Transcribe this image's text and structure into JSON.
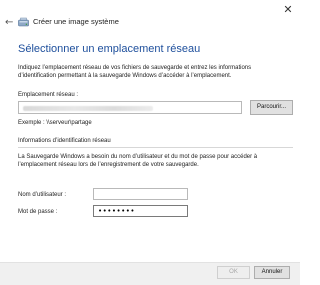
{
  "window": {
    "close_glyph": "✕",
    "back_glyph": "←",
    "app_title": "Créer une image système"
  },
  "page": {
    "title": "Sélectionner un emplacement réseau",
    "intro": "Indiquez l’emplacement réseau de vos fichiers de sauvegarde et entrez les informations d’identification permettant à la sauvegarde Windows d’accéder à l’emplacement."
  },
  "location": {
    "label": "Emplacement réseau :",
    "browse_label": "Parcourir...",
    "example": "Exemple : \\\\serveur\\partage"
  },
  "credentials": {
    "section_title": "Informations d’identification réseau",
    "description": "La Sauvegarde Windows a besoin du nom d’utilisateur et du mot de passe pour accéder à l’emplacement réseau lors de l’enregistrement de votre sauvegarde.",
    "username_label": "Nom d’utilisateur :",
    "password_label": "Mot de passe :",
    "password_value": "••••••••"
  },
  "footer": {
    "ok_label": "OK",
    "cancel_label": "Annuler"
  },
  "colors": {
    "title_blue": "#1e4f9c",
    "footer_bg": "#f0f0f0",
    "disabled_text": "#a8a8a8"
  },
  "icons": {
    "app_icon": "backup-drive-icon"
  }
}
